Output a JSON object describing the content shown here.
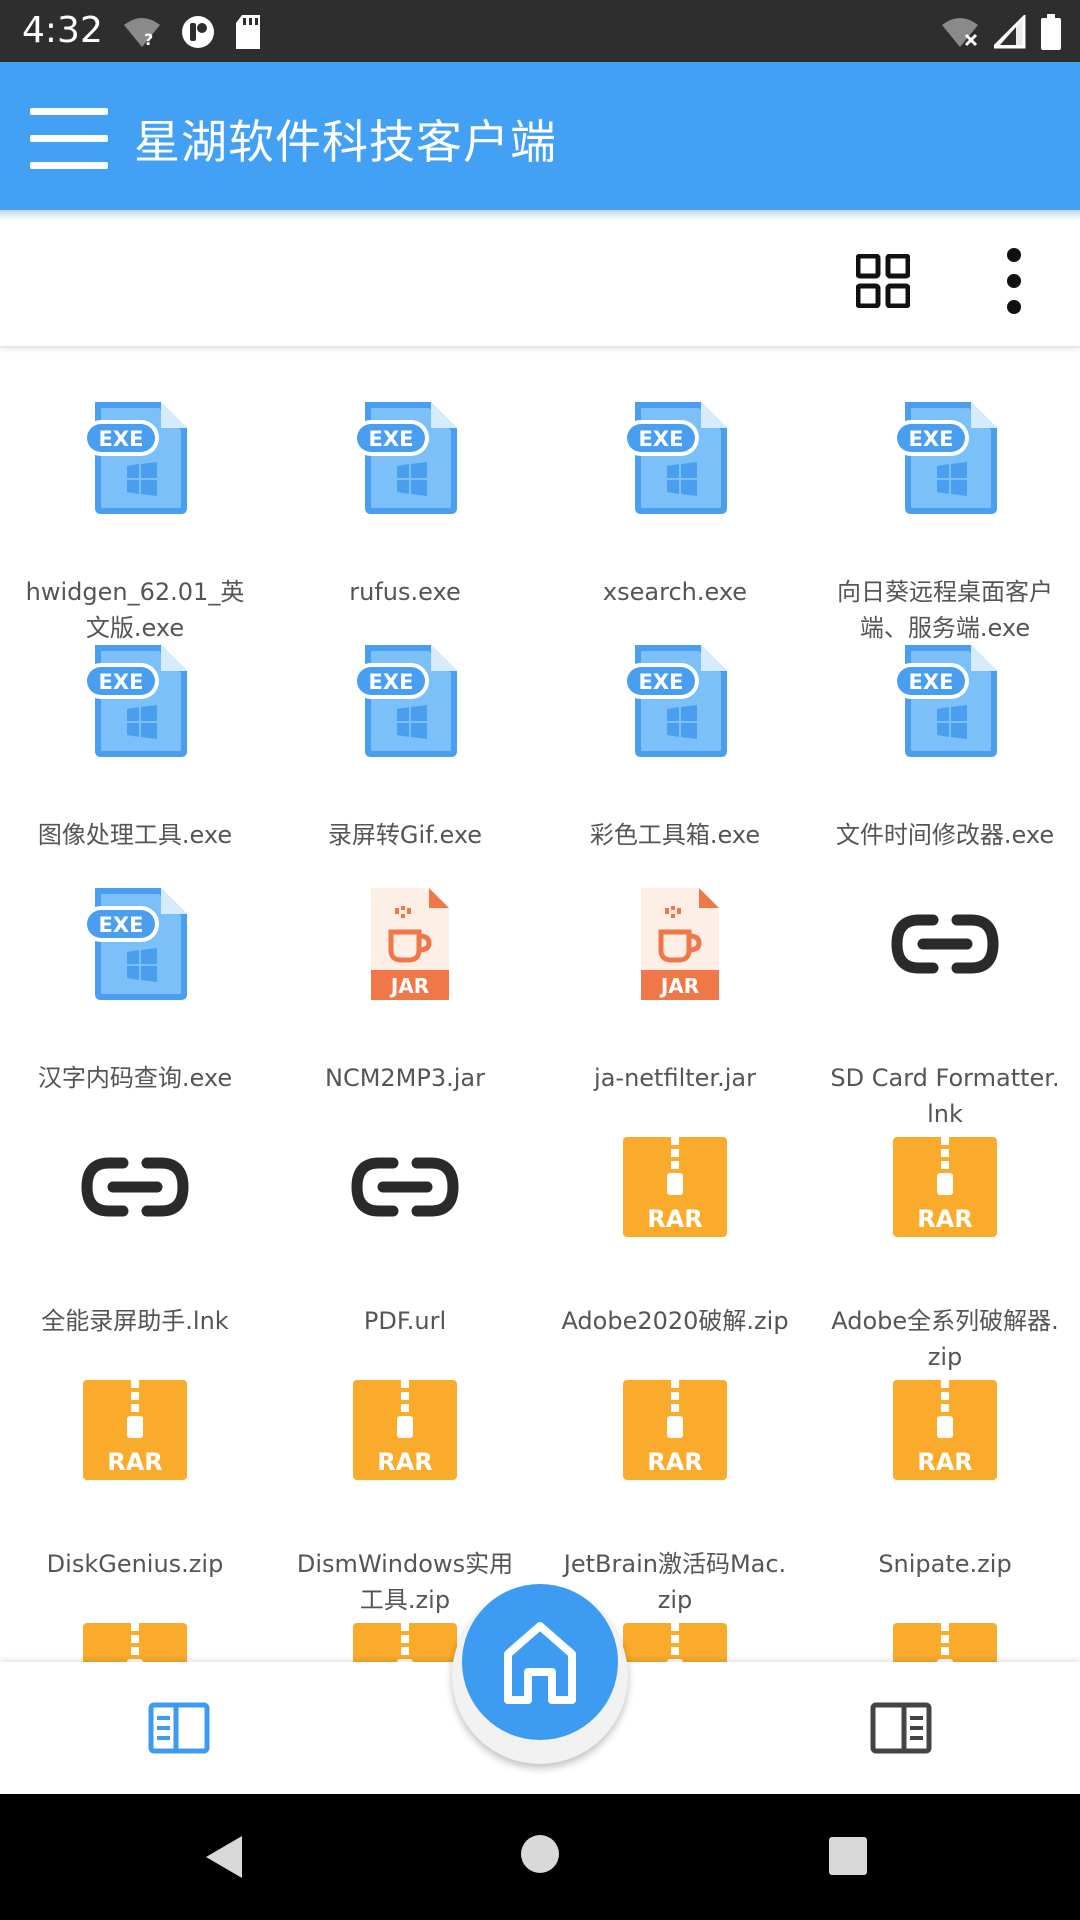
{
  "status_bar": {
    "time": "4:32",
    "left_icons": [
      "wifi-question-icon",
      "app-notification-icon",
      "sd-card-icon"
    ],
    "right_icons": [
      "wifi-off-icon",
      "cell-signal-icon",
      "battery-icon"
    ]
  },
  "app_bar": {
    "title": "星湖软件科技客户端",
    "menu_icon": "hamburger-menu-icon",
    "color": "#42a0f5"
  },
  "toolbar": {
    "icons": [
      "grid-view-icon",
      "more-vert-icon"
    ]
  },
  "files": [
    {
      "name": "hwidgen_62.01_英文版.exe",
      "type": "exe"
    },
    {
      "name": "rufus.exe",
      "type": "exe"
    },
    {
      "name": "xsearch.exe",
      "type": "exe"
    },
    {
      "name": "向日葵远程桌面客户端、服务端.exe",
      "type": "exe"
    },
    {
      "name": "图像处理工具.exe",
      "type": "exe"
    },
    {
      "name": "录屏转Gif.exe",
      "type": "exe"
    },
    {
      "name": "彩色工具箱.exe",
      "type": "exe"
    },
    {
      "name": "文件时间修改器.exe",
      "type": "exe"
    },
    {
      "name": "汉字内码查询.exe",
      "type": "exe"
    },
    {
      "name": "NCM2MP3.jar",
      "type": "jar"
    },
    {
      "name": "ja-netfilter.jar",
      "type": "jar"
    },
    {
      "name": "SD Card Formatter.lnk",
      "type": "link"
    },
    {
      "name": "全能录屏助手.lnk",
      "type": "link"
    },
    {
      "name": "PDF.url",
      "type": "link"
    },
    {
      "name": "Adobe2020破解.zip",
      "type": "rar"
    },
    {
      "name": "Adobe全系列破解器.zip",
      "type": "rar"
    },
    {
      "name": "DiskGenius.zip",
      "type": "rar"
    },
    {
      "name": "DismWindows实用工具.zip",
      "type": "rar"
    },
    {
      "name": "JetBrain激活码Mac.zip",
      "type": "rar"
    },
    {
      "name": "Snipate.zip",
      "type": "rar"
    },
    {
      "name": "",
      "type": "rar"
    },
    {
      "name": "",
      "type": "rar"
    },
    {
      "name": "",
      "type": "rar"
    },
    {
      "name": "",
      "type": "rar"
    }
  ],
  "file_badges": {
    "exe": "EXE",
    "jar": "JAR",
    "rar": "RAR"
  },
  "colors": {
    "exe_blue": "#4a9ef0",
    "exe_light": "#7cc0fa",
    "jar_orange": "#f07848",
    "rar_orange": "#fbab2c",
    "link_dark": "#2a2a2a",
    "fab_blue": "#3d9cf2"
  },
  "bottom_nav": {
    "left_icon": "book-open-left-icon",
    "home_icon": "home-icon",
    "right_icon": "book-open-right-icon"
  },
  "system_nav": [
    "back-icon",
    "home-circle-icon",
    "recents-icon"
  ]
}
